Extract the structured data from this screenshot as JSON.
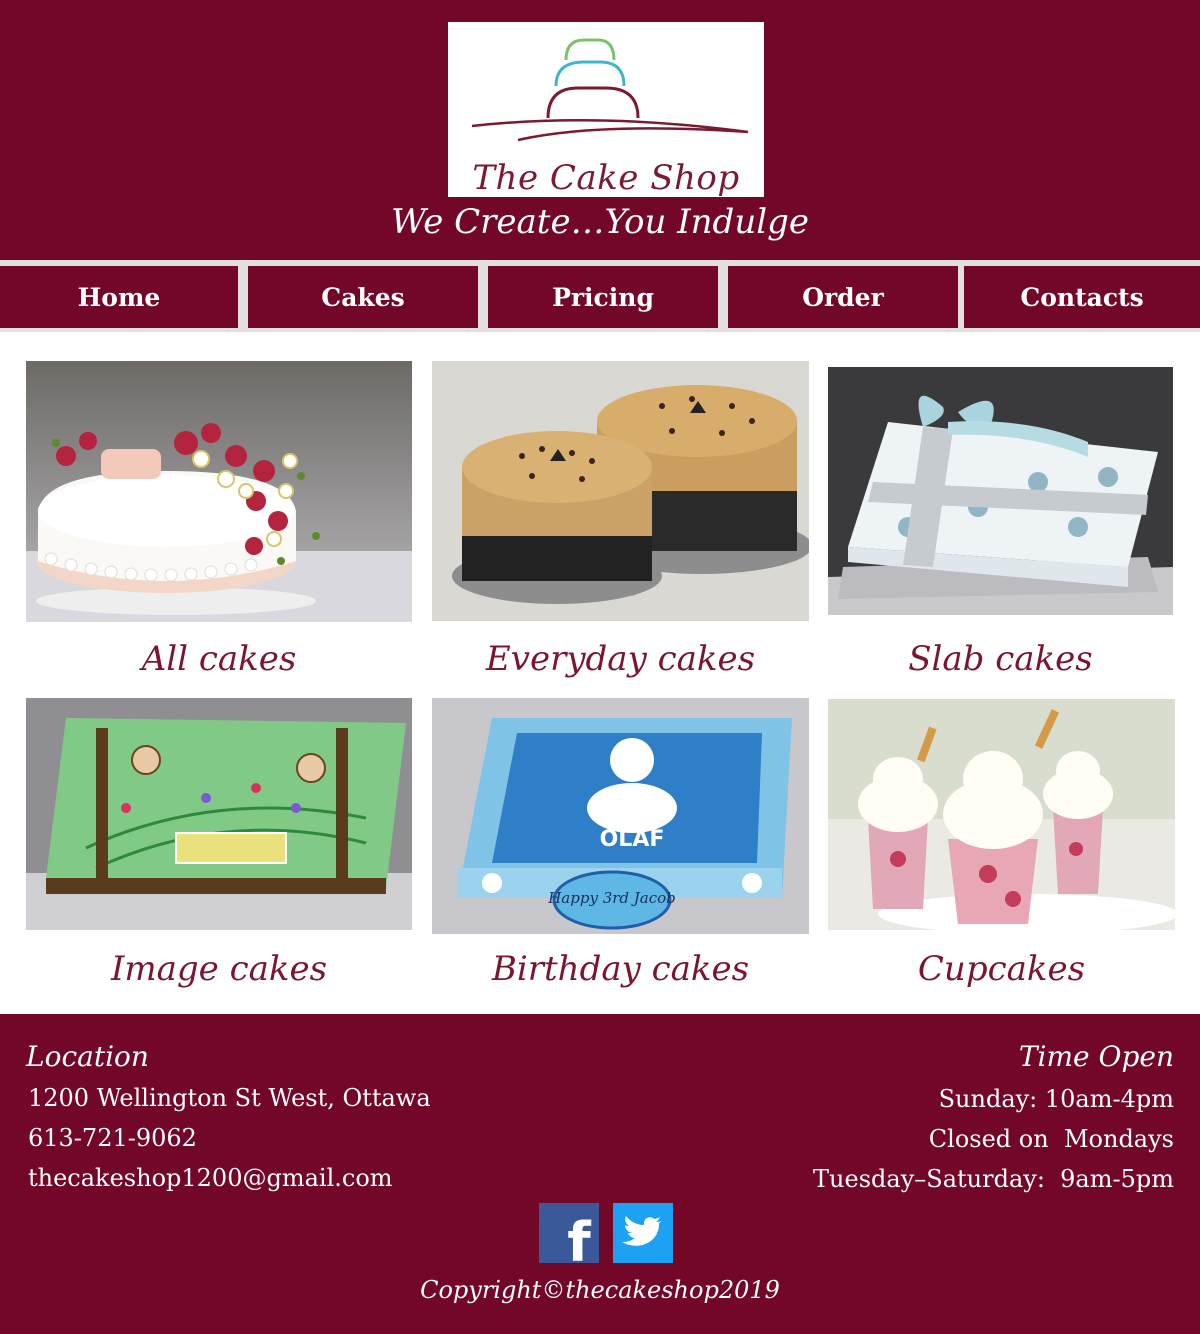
{
  "brand": {
    "logo_text": "The Cake Shop",
    "tagline": "We Create…You Indulge",
    "colors": {
      "primary": "#730727",
      "caption": "#7b1530",
      "nav_separator": "#e3dfe0"
    }
  },
  "nav": {
    "items": [
      {
        "label": "Home"
      },
      {
        "label": "Cakes"
      },
      {
        "label": "Pricing"
      },
      {
        "label": "Order"
      },
      {
        "label": "Contacts"
      }
    ]
  },
  "gallery": {
    "items": [
      {
        "caption": "All cakes",
        "image": "rose-fondant-cake-image"
      },
      {
        "caption": "Everyday cakes",
        "image": "coffee-cakes-image"
      },
      {
        "caption": "Slab cakes",
        "image": "gift-box-slab-cake-image"
      },
      {
        "caption": "Image cakes",
        "image": "monkey-jungle-cake-image"
      },
      {
        "caption": "Birthday cakes",
        "image": "olaf-birthday-cake-image"
      },
      {
        "caption": "Cupcakes",
        "image": "floral-cupcakes-image"
      }
    ],
    "birthday_plaque": "Happy 3rd Jacob",
    "olaf_text": "OLAF"
  },
  "footer": {
    "location": {
      "heading": "Location",
      "address": "1200 Wellington St West, Ottawa",
      "phone": "613-721-9062",
      "email": "thecakeshop1200@gmail.com"
    },
    "hours": {
      "heading": "Time Open",
      "sunday": "Sunday: 10am-4pm",
      "monday": "Closed on  Mondays",
      "weekdays": "Tuesday–Saturday:  9am-5pm"
    },
    "social": [
      {
        "name": "facebook-icon",
        "glyph": "f",
        "color": "#3b5998"
      },
      {
        "name": "twitter-icon",
        "color": "#1da1f2"
      }
    ],
    "copyright": "Copyright©thecakeshop2019"
  }
}
